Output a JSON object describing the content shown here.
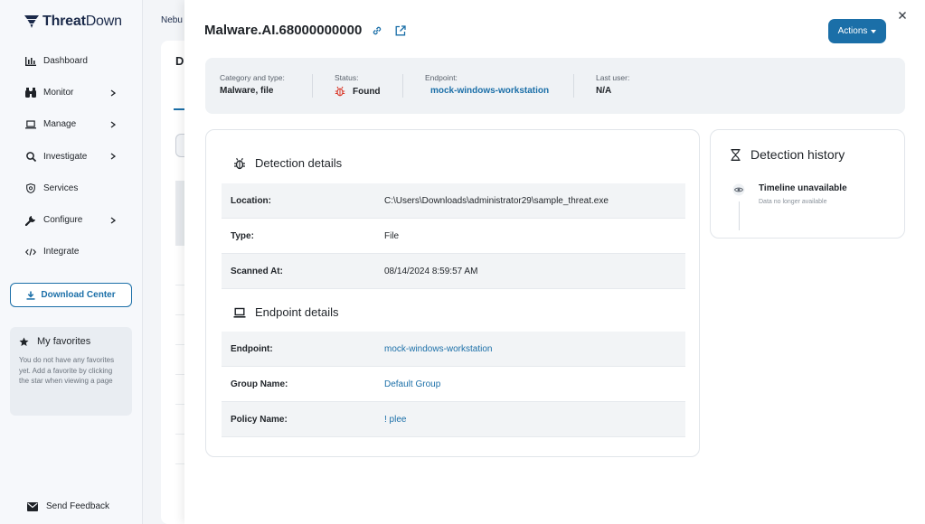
{
  "logo": {
    "bold": "Threat",
    "light": "Down"
  },
  "nav": [
    {
      "label": "Dashboard",
      "icon": "bar-chart-icon",
      "chevron": false
    },
    {
      "label": "Monitor",
      "icon": "binoculars-icon",
      "chevron": true
    },
    {
      "label": "Manage",
      "icon": "laptop-icon",
      "chevron": true
    },
    {
      "label": "Investigate",
      "icon": "search-icon",
      "chevron": true
    },
    {
      "label": "Services",
      "icon": "shield-icon",
      "chevron": false
    },
    {
      "label": "Configure",
      "icon": "wrench-icon",
      "chevron": true
    },
    {
      "label": "Integrate",
      "icon": "code-icon",
      "chevron": false
    }
  ],
  "download_center": "Download Center",
  "favorites": {
    "title": "My favorites",
    "text": "You do not have any favorites yet. Add a favorite by clicking the star when viewing a page"
  },
  "send_feedback": "Send Feedback",
  "background": {
    "crumb": "Nebu",
    "heading": "D"
  },
  "modal": {
    "title": "Malware.AI.68000000000",
    "actions_label": "Actions",
    "summary": {
      "category_label": "Category and type:",
      "category_value": "Malware, file",
      "status_label": "Status:",
      "status_value": "Found",
      "endpoint_label": "Endpoint:",
      "endpoint_value": "mock-windows-workstation",
      "user_label": "Last user:",
      "user_value": "N/A"
    },
    "detection": {
      "title": "Detection details",
      "rows": [
        {
          "key": "Location:",
          "value": "C:\\Users\\Downloads\\administrator29\\sample_threat.exe"
        },
        {
          "key": "Type:",
          "value": "File"
        },
        {
          "key": "Scanned At:",
          "value": "08/14/2024 8:59:57 AM"
        }
      ]
    },
    "endpoint": {
      "title": "Endpoint details",
      "rows": [
        {
          "key": "Endpoint:",
          "value": "mock-windows-workstation"
        },
        {
          "key": "Group Name:",
          "value": "Default Group"
        },
        {
          "key": "Policy Name:",
          "value": "! plee"
        }
      ]
    },
    "history": {
      "title": "Detection history",
      "timeline_title": "Timeline unavailable",
      "timeline_sub": "Data no longer available"
    }
  },
  "colors": {
    "accent": "#1b6fa8",
    "danger": "#d93a2b"
  }
}
